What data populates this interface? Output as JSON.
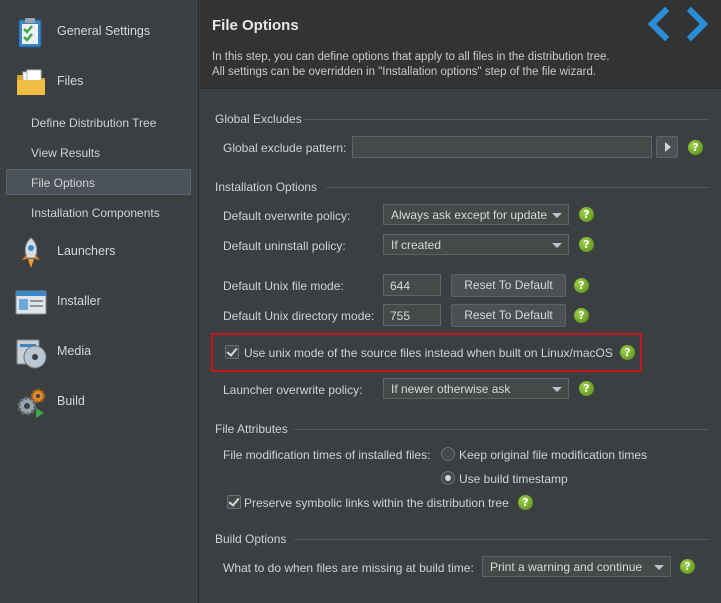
{
  "sidebar": {
    "items": [
      {
        "label": "General Settings",
        "icon": "clipboard-check-icon"
      },
      {
        "label": "Files",
        "icon": "folder-files-icon"
      },
      {
        "label": "Launchers",
        "icon": "rocket-icon"
      },
      {
        "label": "Installer",
        "icon": "installer-window-icon"
      },
      {
        "label": "Media",
        "icon": "media-disc-icon"
      },
      {
        "label": "Build",
        "icon": "gears-build-icon"
      }
    ],
    "sub_items": [
      {
        "label": "Define Distribution Tree"
      },
      {
        "label": "View Results"
      },
      {
        "label": "File Options",
        "selected": true
      },
      {
        "label": "Installation Components"
      }
    ]
  },
  "header": {
    "title": "File Options",
    "desc_line1": "In this step, you can define options that apply to all files in the distribution tree.",
    "desc_line2": "All settings can be overridden in \"Installation options\" step of the file wizard.",
    "back_icon": "chevron-left-icon",
    "forward_icon": "chevron-right-icon"
  },
  "global_excludes": {
    "section_title": "Global Excludes",
    "pattern_label": "Global exclude pattern:",
    "pattern_value": ""
  },
  "installation_options": {
    "section_title": "Installation Options",
    "overwrite_label": "Default overwrite policy:",
    "overwrite_value": "Always ask except for update",
    "uninstall_label": "Default uninstall policy:",
    "uninstall_value": "If created",
    "unix_file_mode_label": "Default Unix file mode:",
    "unix_file_mode_value": "644",
    "unix_dir_mode_label": "Default Unix directory mode:",
    "unix_dir_mode_value": "755",
    "reset_label": "Reset To Default",
    "use_unix_mode_label": "Use unix mode of the source files instead when built on Linux/macOS",
    "use_unix_mode_checked": true,
    "launcher_overwrite_label": "Launcher overwrite policy:",
    "launcher_overwrite_value": "If newer otherwise ask"
  },
  "file_attributes": {
    "section_title": "File Attributes",
    "mod_times_label": "File modification times of installed files:",
    "radio_keep_label": "Keep original file modification times",
    "radio_build_label": "Use build timestamp",
    "selected_radio": "Use build timestamp",
    "preserve_symlinks_label": "Preserve symbolic links within the distribution tree",
    "preserve_symlinks_checked": true
  },
  "build_options": {
    "section_title": "Build Options",
    "missing_label": "What to do when files are missing at build time:",
    "missing_value": "Print a warning and continue"
  },
  "help_glyph": "?",
  "colors": {
    "highlight_border": "#c0161c",
    "help_green": "#6aa820",
    "nav_arrow_blue": "#2a8fd6"
  }
}
